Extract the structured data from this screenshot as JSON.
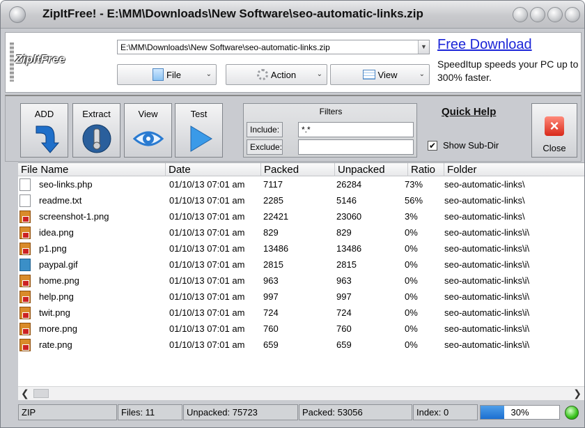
{
  "window": {
    "title": "ZipItFree! - E:\\MM\\Downloads\\New Software\\seo-automatic-links.zip"
  },
  "topbar": {
    "logo_text": "ZipItFree",
    "path": "E:\\MM\\Downloads\\New Software\\seo-automatic-links.zip",
    "file_label": "File",
    "action_label": "Action",
    "view_label": "View",
    "ad_link": "Free Download",
    "ad_text": "SpeedItup speeds your PC up to 300% faster."
  },
  "toolbar": {
    "add_label": "ADD",
    "extract_label": "Extract",
    "view_label": "View",
    "test_label": "Test",
    "filters_title": "Filters",
    "include_label": "Include:",
    "include_value": "*.*",
    "exclude_label": "Exclude:",
    "exclude_value": "",
    "quick_help": "Quick Help",
    "show_subdir_label": "Show Sub-Dir",
    "show_subdir_checked": true,
    "close_label": "Close"
  },
  "columns": [
    "File Name",
    "Date",
    "Packed",
    "Unpacked",
    "Ratio",
    "Folder"
  ],
  "files": [
    {
      "name": "seo-links.php",
      "icon": "doc-icon",
      "date": "01/10/13 07:01 am",
      "packed": "7117",
      "unpacked": "26284",
      "ratio": "73%",
      "folder": "seo-automatic-links\\"
    },
    {
      "name": "readme.txt",
      "icon": "doc-icon",
      "date": "01/10/13 07:01 am",
      "packed": "2285",
      "unpacked": "5146",
      "ratio": "56%",
      "folder": "seo-automatic-links\\"
    },
    {
      "name": "screenshot-1.png",
      "icon": "png-icon",
      "date": "01/10/13 07:01 am",
      "packed": "22421",
      "unpacked": "23060",
      "ratio": "3%",
      "folder": "seo-automatic-links\\"
    },
    {
      "name": "idea.png",
      "icon": "png-icon",
      "date": "01/10/13 07:01 am",
      "packed": "829",
      "unpacked": "829",
      "ratio": "0%",
      "folder": "seo-automatic-links\\i\\"
    },
    {
      "name": "p1.png",
      "icon": "png-icon",
      "date": "01/10/13 07:01 am",
      "packed": "13486",
      "unpacked": "13486",
      "ratio": "0%",
      "folder": "seo-automatic-links\\i\\"
    },
    {
      "name": "paypal.gif",
      "icon": "gif-icon",
      "date": "01/10/13 07:01 am",
      "packed": "2815",
      "unpacked": "2815",
      "ratio": "0%",
      "folder": "seo-automatic-links\\i\\"
    },
    {
      "name": "home.png",
      "icon": "png-icon",
      "date": "01/10/13 07:01 am",
      "packed": "963",
      "unpacked": "963",
      "ratio": "0%",
      "folder": "seo-automatic-links\\i\\"
    },
    {
      "name": "help.png",
      "icon": "png-icon",
      "date": "01/10/13 07:01 am",
      "packed": "997",
      "unpacked": "997",
      "ratio": "0%",
      "folder": "seo-automatic-links\\i\\"
    },
    {
      "name": "twit.png",
      "icon": "png-icon",
      "date": "01/10/13 07:01 am",
      "packed": "724",
      "unpacked": "724",
      "ratio": "0%",
      "folder": "seo-automatic-links\\i\\"
    },
    {
      "name": "more.png",
      "icon": "png-icon",
      "date": "01/10/13 07:01 am",
      "packed": "760",
      "unpacked": "760",
      "ratio": "0%",
      "folder": "seo-automatic-links\\i\\"
    },
    {
      "name": "rate.png",
      "icon": "png-icon",
      "date": "01/10/13 07:01 am",
      "packed": "659",
      "unpacked": "659",
      "ratio": "0%",
      "folder": "seo-automatic-links\\i\\"
    }
  ],
  "status": {
    "type": "ZIP",
    "files": "Files: 11",
    "unpacked": "Unpacked: 75723",
    "packed": "Packed: 53056",
    "index": "Index: 0",
    "progress_text": "30%",
    "progress_value": 0.3
  },
  "colors": {
    "progress_fill": "#1c6fd1",
    "link": "#1b25d8",
    "status_led": "#38c21c",
    "close_button": "#d8291a"
  }
}
